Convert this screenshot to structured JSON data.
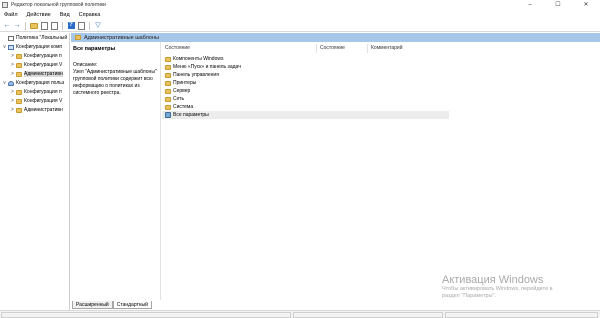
{
  "window": {
    "title": "Редактор локальной групповой политики",
    "controls": [
      "–",
      "☐",
      "✕"
    ]
  },
  "menu": [
    "Файл",
    "Действие",
    "Вид",
    "Справка"
  ],
  "toolbar": {
    "icons": [
      "back-icon",
      "forward-icon",
      "folder-icon",
      "properties-icon",
      "export-icon",
      "help-icon",
      "view-icon",
      "filter-icon"
    ]
  },
  "tree": [
    {
      "label": "Политика \"Локальный",
      "icon": "document",
      "twisty": ""
    },
    {
      "label": "Конфигурация комп",
      "icon": "computer",
      "twisty": "v"
    },
    {
      "label": "Конфигурация п",
      "icon": "folder",
      "twisty": ">"
    },
    {
      "label": "Конфигурация V",
      "icon": "folder",
      "twisty": ">"
    },
    {
      "label": "Административн",
      "icon": "folder",
      "twisty": ">",
      "selected": true
    },
    {
      "label": "Конфигурация польз",
      "icon": "user",
      "twisty": "v"
    },
    {
      "label": "Конфигурация п",
      "icon": "folder",
      "twisty": ">"
    },
    {
      "label": "Конфигурация V",
      "icon": "folder",
      "twisty": ">"
    },
    {
      "label": "Административн",
      "icon": "folder",
      "twisty": ">"
    }
  ],
  "header": {
    "title": "Административные шаблоны"
  },
  "description": {
    "heading": "Все параметры",
    "label": "Описание:",
    "text": "Узел \"Административные шаблоны\" групповой политики содержит всю информацию о политиках из системного реестра."
  },
  "columns": [
    "Состояние",
    "Состояние",
    "Комментарий"
  ],
  "items": [
    {
      "label": "Компоненты Windows",
      "icon": "folder"
    },
    {
      "label": "Меню «Пуск» и панель задач",
      "icon": "folder"
    },
    {
      "label": "Панель управления",
      "icon": "folder"
    },
    {
      "label": "Принтеры",
      "icon": "folder"
    },
    {
      "label": "Сервер",
      "icon": "folder"
    },
    {
      "label": "Сеть",
      "icon": "folder"
    },
    {
      "label": "Система",
      "icon": "folder"
    },
    {
      "label": "Все параметры",
      "icon": "settings",
      "selected": true
    }
  ],
  "tabs": [
    "Расширенный",
    "Стандартный"
  ],
  "watermark": {
    "title": "Активация Windows",
    "line1": "Чтобы активировать Windows, перейдите в",
    "line2": "раздел \"Параметры\"."
  },
  "colors": {
    "header_band": "#a6c7e8",
    "folder": "#e8c35b",
    "accent": "#2a6cc7"
  }
}
